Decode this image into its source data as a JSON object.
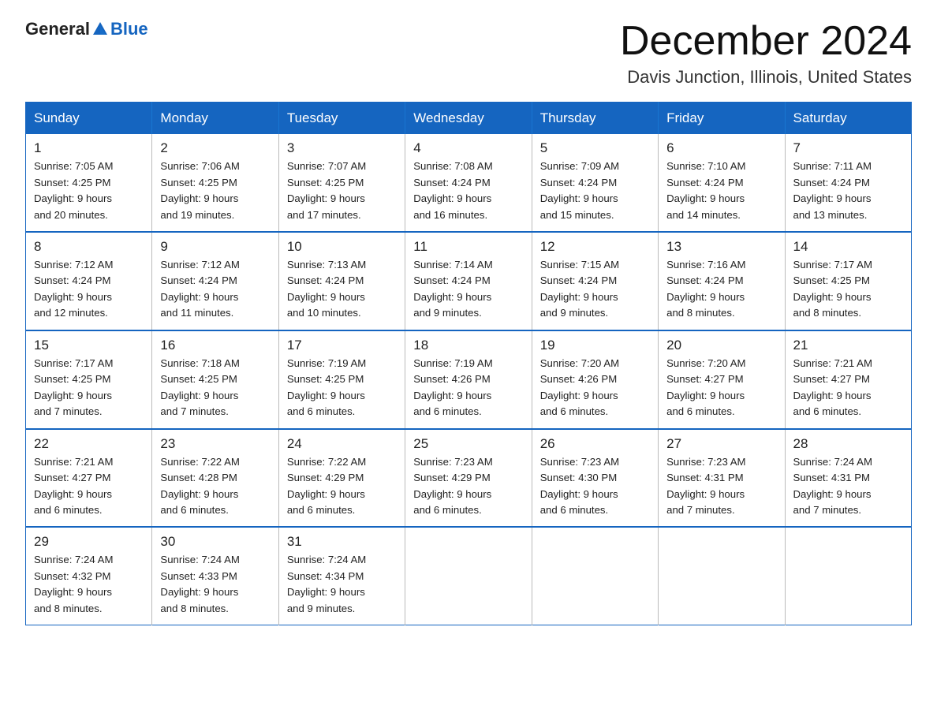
{
  "header": {
    "logo_general": "General",
    "logo_blue": "Blue",
    "month_title": "December 2024",
    "location": "Davis Junction, Illinois, United States"
  },
  "weekdays": [
    "Sunday",
    "Monday",
    "Tuesday",
    "Wednesday",
    "Thursday",
    "Friday",
    "Saturday"
  ],
  "weeks": [
    [
      {
        "day": "1",
        "sunrise": "7:05 AM",
        "sunset": "4:25 PM",
        "daylight": "9 hours and 20 minutes."
      },
      {
        "day": "2",
        "sunrise": "7:06 AM",
        "sunset": "4:25 PM",
        "daylight": "9 hours and 19 minutes."
      },
      {
        "day": "3",
        "sunrise": "7:07 AM",
        "sunset": "4:25 PM",
        "daylight": "9 hours and 17 minutes."
      },
      {
        "day": "4",
        "sunrise": "7:08 AM",
        "sunset": "4:24 PM",
        "daylight": "9 hours and 16 minutes."
      },
      {
        "day": "5",
        "sunrise": "7:09 AM",
        "sunset": "4:24 PM",
        "daylight": "9 hours and 15 minutes."
      },
      {
        "day": "6",
        "sunrise": "7:10 AM",
        "sunset": "4:24 PM",
        "daylight": "9 hours and 14 minutes."
      },
      {
        "day": "7",
        "sunrise": "7:11 AM",
        "sunset": "4:24 PM",
        "daylight": "9 hours and 13 minutes."
      }
    ],
    [
      {
        "day": "8",
        "sunrise": "7:12 AM",
        "sunset": "4:24 PM",
        "daylight": "9 hours and 12 minutes."
      },
      {
        "day": "9",
        "sunrise": "7:12 AM",
        "sunset": "4:24 PM",
        "daylight": "9 hours and 11 minutes."
      },
      {
        "day": "10",
        "sunrise": "7:13 AM",
        "sunset": "4:24 PM",
        "daylight": "9 hours and 10 minutes."
      },
      {
        "day": "11",
        "sunrise": "7:14 AM",
        "sunset": "4:24 PM",
        "daylight": "9 hours and 9 minutes."
      },
      {
        "day": "12",
        "sunrise": "7:15 AM",
        "sunset": "4:24 PM",
        "daylight": "9 hours and 9 minutes."
      },
      {
        "day": "13",
        "sunrise": "7:16 AM",
        "sunset": "4:24 PM",
        "daylight": "9 hours and 8 minutes."
      },
      {
        "day": "14",
        "sunrise": "7:17 AM",
        "sunset": "4:25 PM",
        "daylight": "9 hours and 8 minutes."
      }
    ],
    [
      {
        "day": "15",
        "sunrise": "7:17 AM",
        "sunset": "4:25 PM",
        "daylight": "9 hours and 7 minutes."
      },
      {
        "day": "16",
        "sunrise": "7:18 AM",
        "sunset": "4:25 PM",
        "daylight": "9 hours and 7 minutes."
      },
      {
        "day": "17",
        "sunrise": "7:19 AM",
        "sunset": "4:25 PM",
        "daylight": "9 hours and 6 minutes."
      },
      {
        "day": "18",
        "sunrise": "7:19 AM",
        "sunset": "4:26 PM",
        "daylight": "9 hours and 6 minutes."
      },
      {
        "day": "19",
        "sunrise": "7:20 AM",
        "sunset": "4:26 PM",
        "daylight": "9 hours and 6 minutes."
      },
      {
        "day": "20",
        "sunrise": "7:20 AM",
        "sunset": "4:27 PM",
        "daylight": "9 hours and 6 minutes."
      },
      {
        "day": "21",
        "sunrise": "7:21 AM",
        "sunset": "4:27 PM",
        "daylight": "9 hours and 6 minutes."
      }
    ],
    [
      {
        "day": "22",
        "sunrise": "7:21 AM",
        "sunset": "4:27 PM",
        "daylight": "9 hours and 6 minutes."
      },
      {
        "day": "23",
        "sunrise": "7:22 AM",
        "sunset": "4:28 PM",
        "daylight": "9 hours and 6 minutes."
      },
      {
        "day": "24",
        "sunrise": "7:22 AM",
        "sunset": "4:29 PM",
        "daylight": "9 hours and 6 minutes."
      },
      {
        "day": "25",
        "sunrise": "7:23 AM",
        "sunset": "4:29 PM",
        "daylight": "9 hours and 6 minutes."
      },
      {
        "day": "26",
        "sunrise": "7:23 AM",
        "sunset": "4:30 PM",
        "daylight": "9 hours and 6 minutes."
      },
      {
        "day": "27",
        "sunrise": "7:23 AM",
        "sunset": "4:31 PM",
        "daylight": "9 hours and 7 minutes."
      },
      {
        "day": "28",
        "sunrise": "7:24 AM",
        "sunset": "4:31 PM",
        "daylight": "9 hours and 7 minutes."
      }
    ],
    [
      {
        "day": "29",
        "sunrise": "7:24 AM",
        "sunset": "4:32 PM",
        "daylight": "9 hours and 8 minutes."
      },
      {
        "day": "30",
        "sunrise": "7:24 AM",
        "sunset": "4:33 PM",
        "daylight": "9 hours and 8 minutes."
      },
      {
        "day": "31",
        "sunrise": "7:24 AM",
        "sunset": "4:34 PM",
        "daylight": "9 hours and 9 minutes."
      },
      null,
      null,
      null,
      null
    ]
  ],
  "labels": {
    "sunrise": "Sunrise:",
    "sunset": "Sunset:",
    "daylight": "Daylight:"
  }
}
